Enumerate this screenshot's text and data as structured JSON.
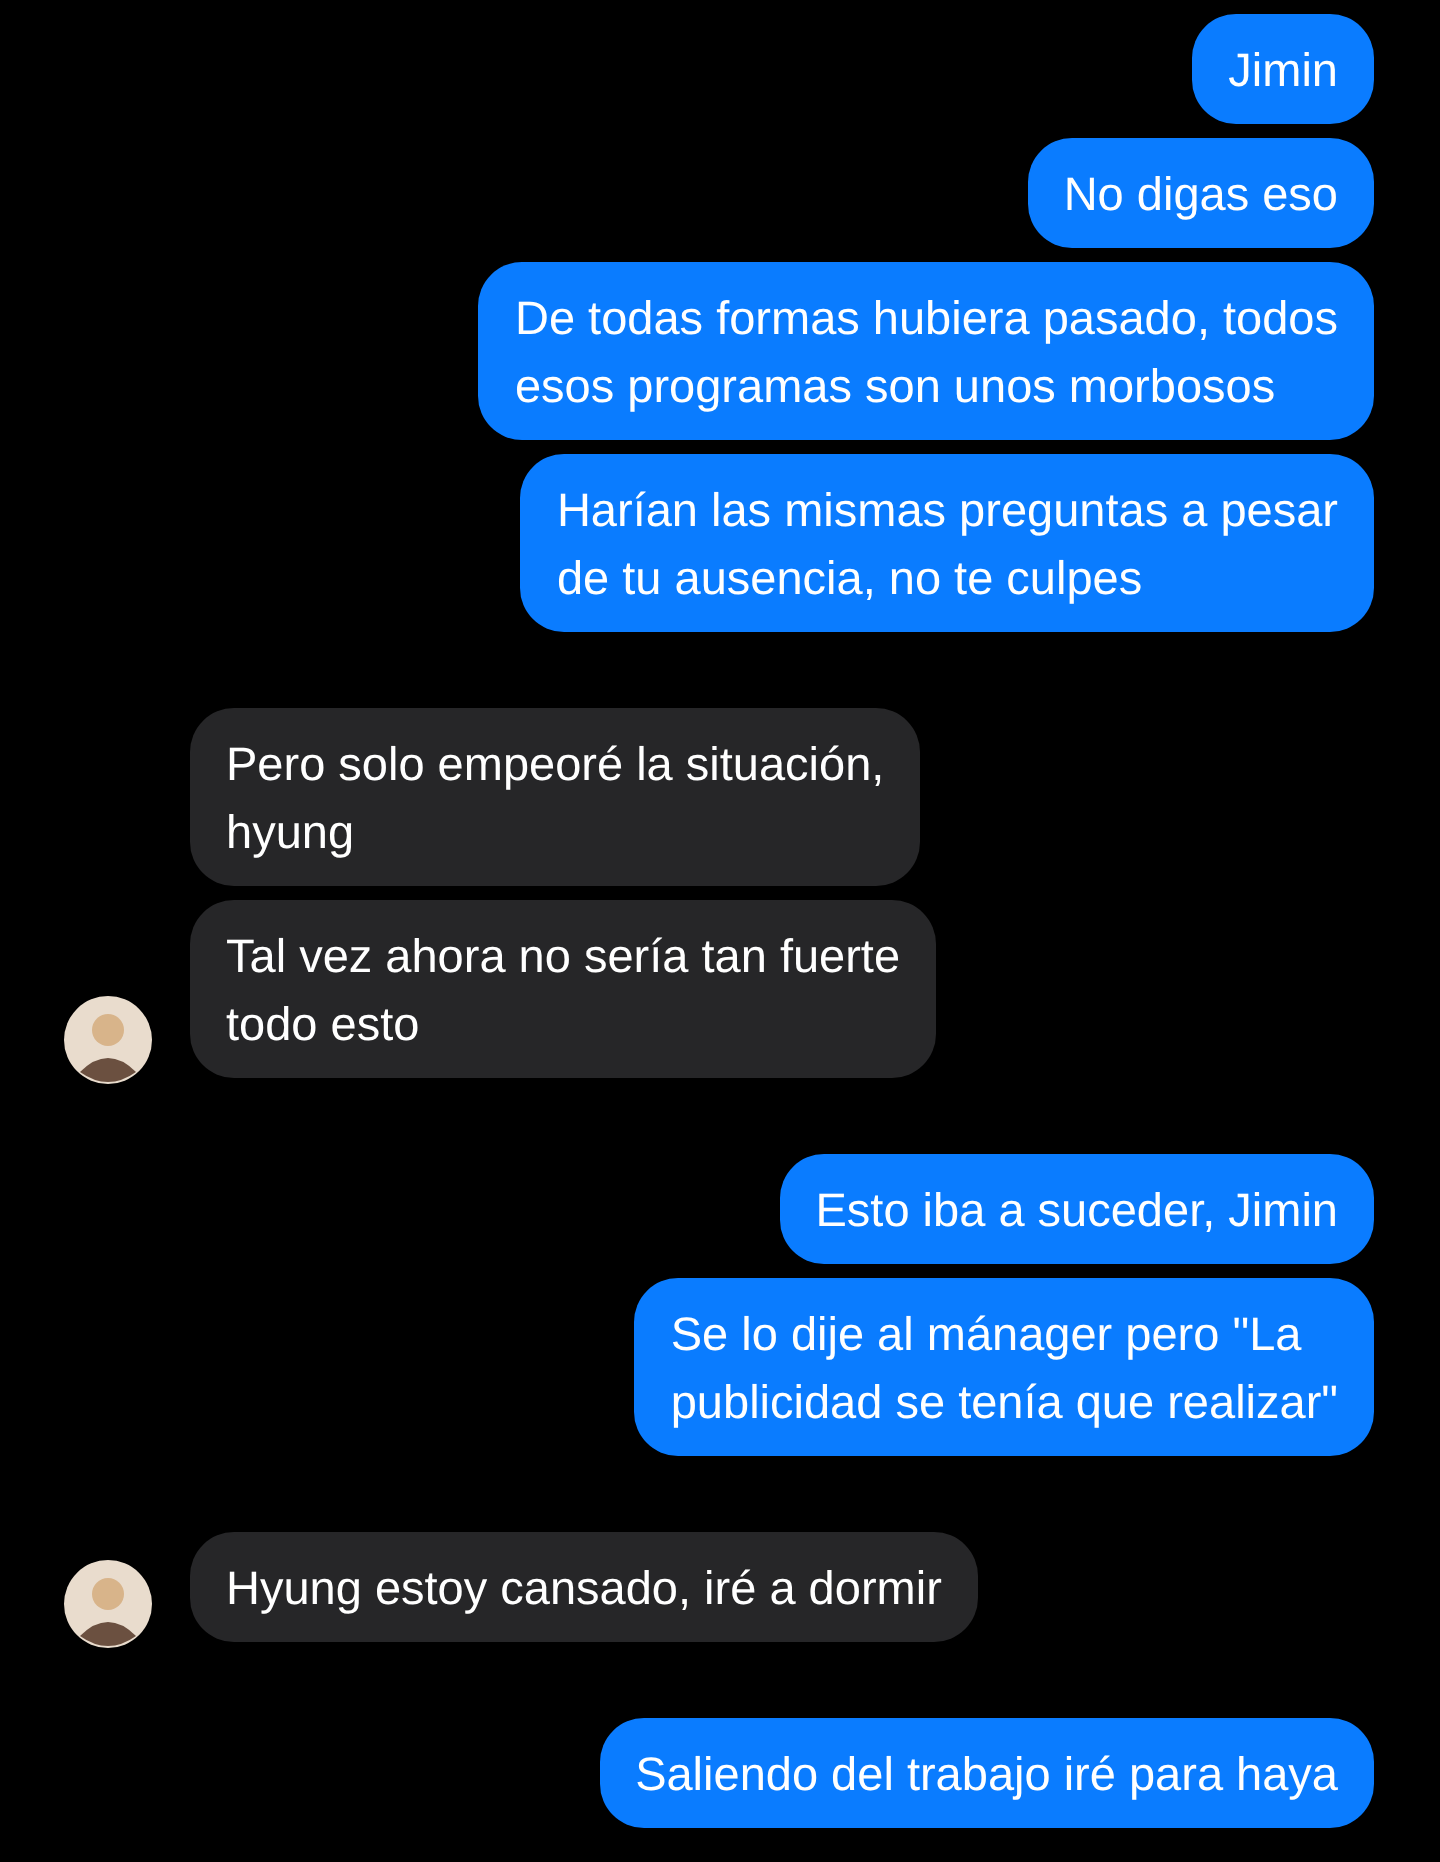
{
  "groups": [
    {
      "kind": "sent",
      "messages": [
        "Jimin",
        "No digas eso",
        "De todas formas hubiera pasado, todos\nesos programas son unos morbosos",
        "Harían las mismas preguntas a pesar\nde tu ausencia, no te culpes"
      ]
    },
    {
      "kind": "received",
      "avatar": true,
      "messages": [
        "Pero solo empeoré la situación,\nhyung",
        "Tal vez ahora no sería tan fuerte\ntodo esto"
      ]
    },
    {
      "kind": "sent",
      "messages": [
        "Esto iba a suceder, Jimin",
        "Se lo dije al mánager pero \"La\npublicidad se tenía que realizar\""
      ]
    },
    {
      "kind": "received",
      "avatar": true,
      "messages": [
        "Hyung estoy cansado, iré a dormir"
      ]
    },
    {
      "kind": "sent",
      "messages": [
        "Saliendo del trabajo iré para haya"
      ]
    }
  ]
}
